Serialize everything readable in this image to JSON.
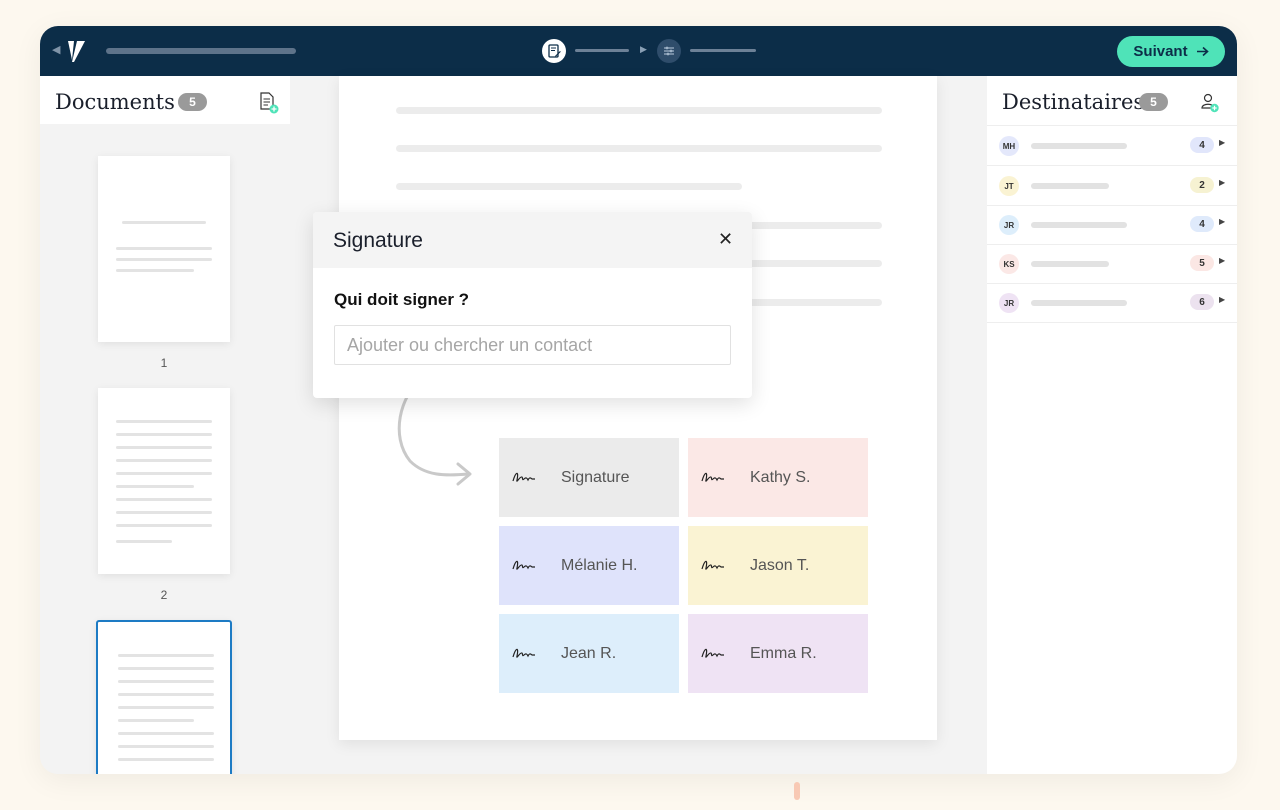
{
  "topbar": {
    "next_label": "Suivant",
    "next_icon": "arrow-right-icon",
    "step1_icon": "document-edit-icon",
    "step2_icon": "sliders-icon"
  },
  "left_panel": {
    "title": "Documents",
    "count": "5",
    "pages": [
      {
        "number": "1"
      },
      {
        "number": "2"
      },
      {
        "number": ""
      }
    ],
    "selected_page_index": 2
  },
  "modal": {
    "title": "Signature",
    "question": "Qui doit signer ?",
    "input_placeholder": "Ajouter ou chercher un contact",
    "input_value": ""
  },
  "signature_cards": [
    {
      "label": "Signature",
      "color": "#ebebeb"
    },
    {
      "label": "Kathy S.",
      "color": "#fbe8e6"
    },
    {
      "label": "Mélanie H.",
      "color": "#dfe3fb"
    },
    {
      "label": "Jason T.",
      "color": "#faf3d3"
    },
    {
      "label": "Jean R.",
      "color": "#ddeefb"
    },
    {
      "label": "Emma R.",
      "color": "#efe3f4"
    }
  ],
  "right_panel": {
    "title": "Destinataires",
    "count": "5",
    "recipients": [
      {
        "initials": "MH",
        "count": "4",
        "avatar_color": "#e4e8fb",
        "count_color": "#e1e6fb"
      },
      {
        "initials": "JT",
        "count": "2",
        "avatar_color": "#faf3d3",
        "count_color": "#f6f2d2"
      },
      {
        "initials": "JR",
        "count": "4",
        "avatar_color": "#ddeefb",
        "count_color": "#dfeafb"
      },
      {
        "initials": "KS",
        "count": "5",
        "avatar_color": "#fbe8e6",
        "count_color": "#fbe7e4"
      },
      {
        "initials": "JR",
        "count": "6",
        "avatar_color": "#efe3f4",
        "count_color": "#ece2ef"
      }
    ]
  },
  "colors": {
    "topbar": "#0c2d48",
    "accent": "#4fe3b8",
    "selected_border": "#1d7bc4"
  }
}
